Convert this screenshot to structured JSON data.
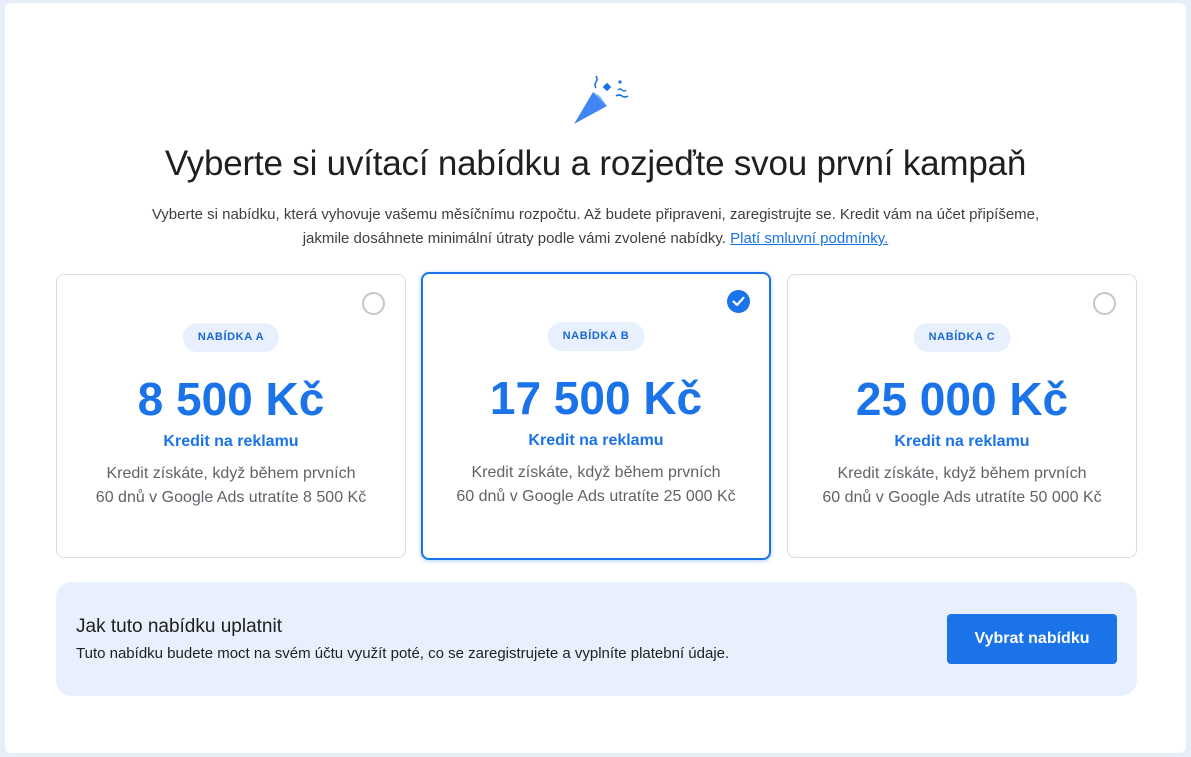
{
  "header": {
    "title": "Vyberte si uvítací nabídku a rozjeďte svou první kampaň",
    "subtitle_line1": "Vyberte si nabídku, která vyhovuje vašemu měsíčnímu rozpočtu. Až budete připraveni, zaregistrujte se. Kredit vám na účet připíšeme,",
    "subtitle_line2": "jakmile dosáhnete minimální útraty podle vámi zvolené nabídky.",
    "terms_link": "Platí smluvní podmínky."
  },
  "offers": [
    {
      "badge": "NABÍDKA A",
      "amount": "8 500 Kč",
      "credit_label": "Kredit na reklamu",
      "desc_line1": "Kredit získáte, když během prvních",
      "desc_line2": "60 dnů v Google Ads utratíte 8 500 Kč",
      "selected": false
    },
    {
      "badge": "NABÍDKA B",
      "amount": "17 500 Kč",
      "credit_label": "Kredit na reklamu",
      "desc_line1": "Kredit získáte, když během prvních",
      "desc_line2": "60 dnů v Google Ads utratíte 25 000 Kč",
      "selected": true
    },
    {
      "badge": "NABÍDKA C",
      "amount": "25 000 Kč",
      "credit_label": "Kredit na reklamu",
      "desc_line1": "Kredit získáte, když během prvních",
      "desc_line2": "60 dnů v Google Ads utratíte 50 000 Kč",
      "selected": false
    }
  ],
  "info": {
    "title": "Jak tuto nabídku uplatnit",
    "text": "Tuto nabídku budete moct na svém účtu využít poté, co se zaregistrujete a vyplníte platební údaje.",
    "button_label": "Vybrat nabídku"
  },
  "icons": {
    "celebration": "party-popper-icon",
    "check": "check-icon"
  },
  "colors": {
    "accent": "#1a73e8",
    "badge_bg": "#e8f0fe",
    "info_bg": "#e8f0fe"
  }
}
